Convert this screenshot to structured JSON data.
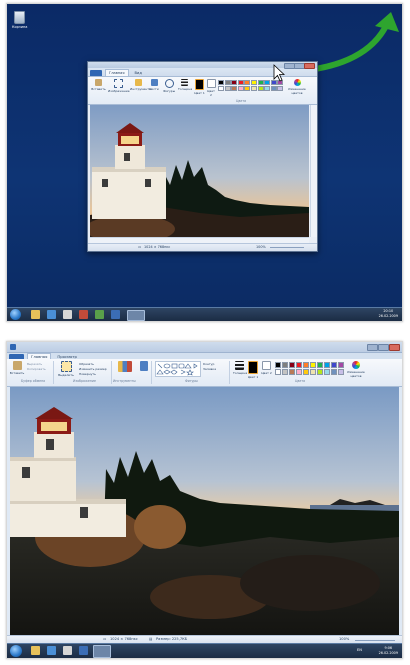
{
  "top_desktop": {
    "recycle_bin_label": "Корзина",
    "paint_window": {
      "tabs": [
        "Главная",
        "Вид"
      ],
      "ribbon": {
        "paste": "Вставить",
        "select": "Выделить",
        "image": "Изображение",
        "tools": "Инструменты",
        "brushes": "Кисти",
        "shapes": "Фигуры",
        "outline": "Контур",
        "size": "Толщина",
        "color1": "Цвет 1",
        "color2": "Цвет 2",
        "edit_colors": "Изменение цветов",
        "colors_group": "Цвета"
      },
      "status": {
        "dimensions": "1024 × 768пкс",
        "zoom": "100%"
      }
    },
    "taskbar": {
      "clock_time": "20:10",
      "clock_date": "26.02.2009"
    }
  },
  "bottom_maximized": {
    "tabs": [
      "Главная",
      "Просмотр"
    ],
    "ribbon": {
      "paste": "Вставить",
      "cut": "Вырезать",
      "copy": "Копировать",
      "select": "Выделить",
      "crop": "Обрезать",
      "resize": "Изменить размер",
      "rotate": "Повернуть",
      "outline": "Контур",
      "fill": "Заливка",
      "size": "Толщина",
      "color1": "Цвет 1",
      "color2": "Цвет 2",
      "edit_colors": "Изменение цветов",
      "groups": {
        "clipboard": "Буфер обмена",
        "image": "Изображение",
        "tools": "Инструменты",
        "shapes": "Фигуры",
        "colors": "Цвета"
      }
    },
    "status": {
      "dimensions": "1024 × 768пкс",
      "file_size": "Размер: 225,7КБ",
      "zoom": "100%"
    },
    "taskbar": {
      "language": "EN",
      "clock_time": "9:06",
      "clock_date": "26.02.2009"
    }
  },
  "palette_colors": [
    "#000000",
    "#7f7f7f",
    "#880015",
    "#ed1c24",
    "#ff7f27",
    "#fff200",
    "#22b14c",
    "#00a2e8",
    "#3f48cc",
    "#a349a4",
    "#ffffff",
    "#c3c3c3",
    "#b97a57",
    "#ffaec9",
    "#ffc90e",
    "#efe4b0",
    "#b5e61d",
    "#99d9ea",
    "#7092be",
    "#c8bfe7"
  ],
  "accent_colors": {
    "desktop": "#0e3474",
    "ribbon": "#dfe9f5",
    "arrow": "#2ea52e",
    "file_tab": "#2f66b3"
  }
}
